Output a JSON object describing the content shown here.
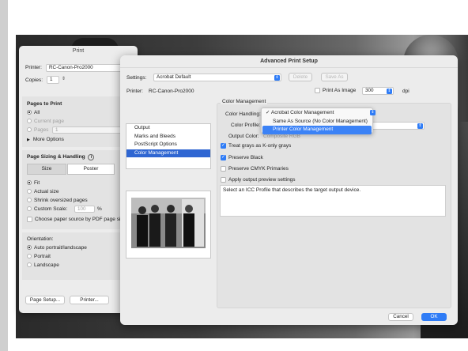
{
  "print_dialog": {
    "title": "Print",
    "printer_label": "Printer:",
    "printer_value": "RC-Canon-Pro2000",
    "copies_label": "Copies:",
    "copies_value": "1",
    "pages_heading": "Pages to Print",
    "pages_all": "All",
    "pages_current": "Current page",
    "pages_pages": "Pages",
    "pages_value": "1",
    "more_options": "More Options",
    "sizing_heading": "Page Sizing & Handling",
    "tab_size": "Size",
    "tab_poster": "Poster",
    "fit": "Fit",
    "actual_size": "Actual size",
    "shrink": "Shrink oversized pages",
    "custom_scale": "Custom Scale:",
    "custom_scale_value": "100",
    "percent": "%",
    "choose_paper": "Choose paper source by PDF page size",
    "orientation_heading": "Orientation:",
    "orient_auto": "Auto portrait/landscape",
    "orient_portrait": "Portrait",
    "orient_landscape": "Landscape",
    "page_setup_btn": "Page Setup...",
    "printer_btn": "Printer..."
  },
  "advanced": {
    "title": "Advanced Print Setup",
    "settings_label": "Settings:",
    "settings_value": "Acrobat Default",
    "delete_btn": "Delete",
    "save_as_btn": "Save As",
    "printer_label": "Printer:",
    "printer_value": "RC-Canon-Pro2000",
    "print_as_image": "Print As Image",
    "dpi_value": "300",
    "dpi_label": "dpi",
    "list_items": [
      "Output",
      "Marks and Bleeds",
      "PostScript Options",
      "Color Management"
    ],
    "cm_heading": "Color Management",
    "color_handling_label": "Color Handling:",
    "color_profile_label": "Color Profile:",
    "output_color_label": "Output Color:",
    "output_color_value": "Composite RGB",
    "menu_items": [
      "✓ Acrobat Color Management",
      "Same As Source (No Color Management)",
      "Printer Color Management"
    ],
    "treat_grays": "Treat grays as K-only grays",
    "preserve_black": "Preserve Black",
    "preserve_cmyk": "Preserve CMYK Primaries",
    "apply_preview": "Apply output preview settings",
    "description": "Select an ICC Profile that describes the target output device.",
    "cancel_btn": "Cancel",
    "ok_btn": "OK"
  },
  "colors": {
    "accent": "#2f7cf6",
    "selection": "#2f66d2"
  }
}
